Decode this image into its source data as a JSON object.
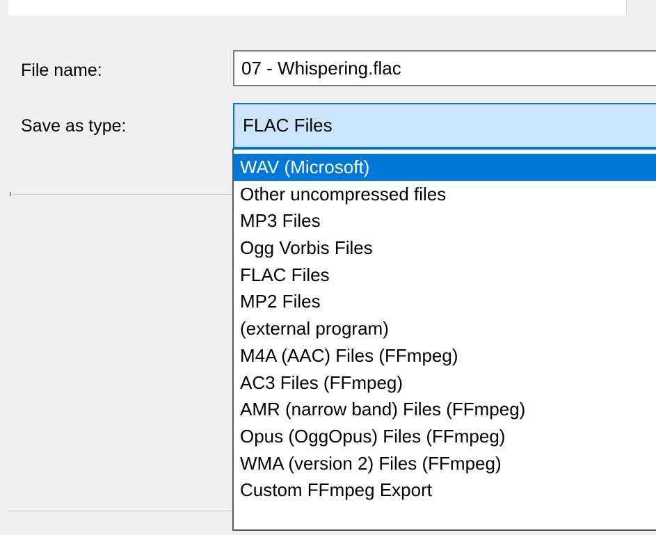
{
  "labels": {
    "file_name": "File name:",
    "save_as_type": "Save as type:"
  },
  "file_name": {
    "value": "07 - Whispering.flac"
  },
  "save_as_type": {
    "selected": "FLAC Files",
    "highlighted": "WAV (Microsoft)",
    "options": [
      "WAV (Microsoft)",
      "Other uncompressed files",
      "MP3 Files",
      "Ogg Vorbis Files",
      "FLAC Files",
      "MP2 Files",
      "(external program)",
      "M4A (AAC) Files (FFmpeg)",
      "AC3 Files (FFmpeg)",
      "AMR (narrow band) Files (FFmpeg)",
      "Opus (OggOpus) Files (FFmpeg)",
      "WMA (version 2) Files (FFmpeg)",
      "Custom FFmpeg Export"
    ]
  },
  "colors": {
    "highlight": "#0078d7",
    "combo_background": "#cce4f7",
    "dialog_background": "#f0f0f0"
  }
}
